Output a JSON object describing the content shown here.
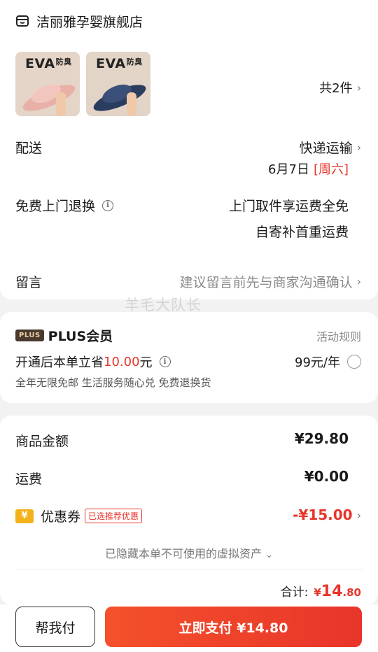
{
  "store": {
    "name": "洁丽雅孕婴旗舰店",
    "icon": "store-icon"
  },
  "products": {
    "items": [
      {
        "label": "EVA",
        "label_cn": "防臭",
        "color": "#e9b0a8"
      },
      {
        "label": "EVA",
        "label_cn": "防臭",
        "color": "#2b3d5e"
      }
    ],
    "count_text": "共2件"
  },
  "delivery": {
    "label": "配送",
    "method": "快递运输",
    "date": "6月7日",
    "weekday": "[周六]"
  },
  "returns": {
    "label": "免费上门退换",
    "line1": "上门取件享运费全免",
    "line2": "自寄补首重运费"
  },
  "message": {
    "label": "留言",
    "placeholder": "建议留言前先与商家沟通确认"
  },
  "watermark": "羊毛大队长",
  "plus": {
    "badge": "PLUS",
    "title": "PLUS会员",
    "rules": "活动规则",
    "save_prefix": "开通后本单立省",
    "save_amount": "10.00",
    "save_suffix": "元",
    "price": "99元/年",
    "benefits": "全年无限免邮  生活服务随心兑  免费退换货"
  },
  "amounts": {
    "goods_label": "商品金额",
    "goods_value": "¥29.80",
    "shipping_label": "运费",
    "shipping_value": "¥0.00",
    "coupon_icon_text": "¥",
    "coupon_label": "优惠券",
    "coupon_tag": "已选推荐优惠",
    "coupon_value": "-¥15.00",
    "hidden_note": "已隐藏本单不可使用的虚拟资产",
    "total_label": "合计:",
    "total_yen": "¥",
    "total_int": "14",
    "total_dec": ".80"
  },
  "actions": {
    "help_pay": "帮我付",
    "pay_now": "立即支付 ¥14.80"
  },
  "colors": {
    "accent": "#e8352b",
    "plus_badge": "#4a3a2e",
    "coupon": "#f3b21b"
  }
}
